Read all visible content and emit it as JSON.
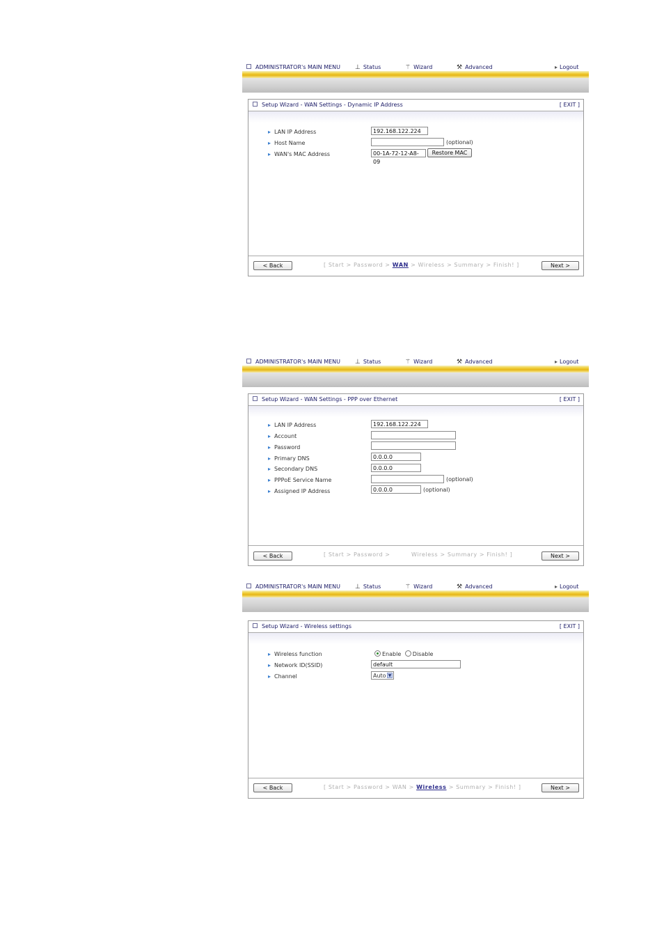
{
  "menu": {
    "main_menu": "ADMINISTRATOR's MAIN MENU",
    "status": "Status",
    "wizard": "Wizard",
    "advanced": "Advanced",
    "logout": "Logout"
  },
  "common": {
    "exit": "[ EXIT ]",
    "back": "< Back",
    "next": "Next >",
    "optional": "(optional)"
  },
  "screen1": {
    "title": "Setup Wizard - WAN Settings - Dynamic IP Address",
    "lan_ip_label": "LAN IP Address",
    "lan_ip_value": "192.168.122.224",
    "host_name_label": "Host Name",
    "host_name_value": "",
    "mac_label": "WAN's MAC Address",
    "mac_value": "00-1A-72-12-A8-09",
    "restore_mac": "Restore MAC",
    "steps_before": "[ Start > Password >",
    "steps_current": "WAN",
    "steps_after": "> Wireless > Summary > Finish! ]"
  },
  "screen2": {
    "title": "Setup Wizard - WAN Settings - PPP over Ethernet",
    "lan_ip_label": "LAN IP Address",
    "lan_ip_value": "192.168.122.224",
    "account_label": "Account",
    "account_value": "",
    "password_label": "Password",
    "password_value": "",
    "primary_dns_label": "Primary DNS",
    "primary_dns_value": "0.0.0.0",
    "secondary_dns_label": "Secondary DNS",
    "secondary_dns_value": "0.0.0.0",
    "pppoe_label": "PPPoE Service Name",
    "pppoe_value": "",
    "assigned_ip_label": "Assigned IP Address",
    "assigned_ip_value": "0.0.0.0",
    "steps_before": "[ Start > Password >",
    "steps_after": "Wireless > Summary > Finish! ]"
  },
  "screen3": {
    "title": "Setup Wizard - Wireless settings",
    "wireless_label": "Wireless function",
    "enable": "Enable",
    "disable": "Disable",
    "ssid_label": "Network ID(SSID)",
    "ssid_value": "default",
    "channel_label": "Channel",
    "channel_value": "Auto",
    "steps_before": "[ Start > Password > WAN >",
    "steps_current": "Wireless",
    "steps_after": "> Summary > Finish! ]"
  }
}
